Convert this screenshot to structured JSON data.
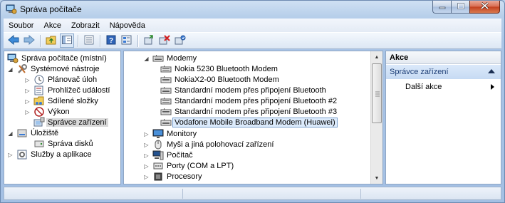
{
  "window": {
    "title": "Správa počítače"
  },
  "menu": [
    "Soubor",
    "Akce",
    "Zobrazit",
    "Nápověda"
  ],
  "toolbar": {
    "buttons": [
      "back-icon",
      "forward-icon",
      "up-folder-icon",
      "show-hide-tree-icon",
      "properties-icon",
      "help-icon",
      "device-view-icon",
      "scan-hardware-icon",
      "update-driver-icon",
      "uninstall-icon",
      "disable-icon"
    ]
  },
  "left_tree": {
    "root": "Správa počítače (místní)",
    "system_tools": "Systémové nástroje",
    "task_scheduler": "Plánovač úloh",
    "event_viewer": "Prohlížeč událostí",
    "shared_folders": "Sdílené složky",
    "performance": "Výkon",
    "device_manager": "Správce zařízení",
    "storage": "Úložiště",
    "disk_management": "Správa disků",
    "services_apps": "Služby a aplikace"
  },
  "device_tree": {
    "modems_group": "Modemy",
    "modems": [
      "Nokia 5230 Bluetooth Modem",
      "NokiaX2-00 Bluetooth Modem",
      "Standardní modem přes připojení Bluetooth",
      "Standardní modem přes připojení Bluetooth #2",
      "Standardní modem přes připojení Bluetooth #3",
      "Vodafone Mobile Broadband Modem (Huawei)"
    ],
    "selected_modem_index": 5,
    "other_groups": [
      "Monitory",
      "Myši a jiná polohovací zařízení",
      "Počítač",
      "Porty (COM a LPT)",
      "Procesory"
    ]
  },
  "actions": {
    "header": "Akce",
    "section": "Správce zařízení",
    "more": "Další akce"
  }
}
